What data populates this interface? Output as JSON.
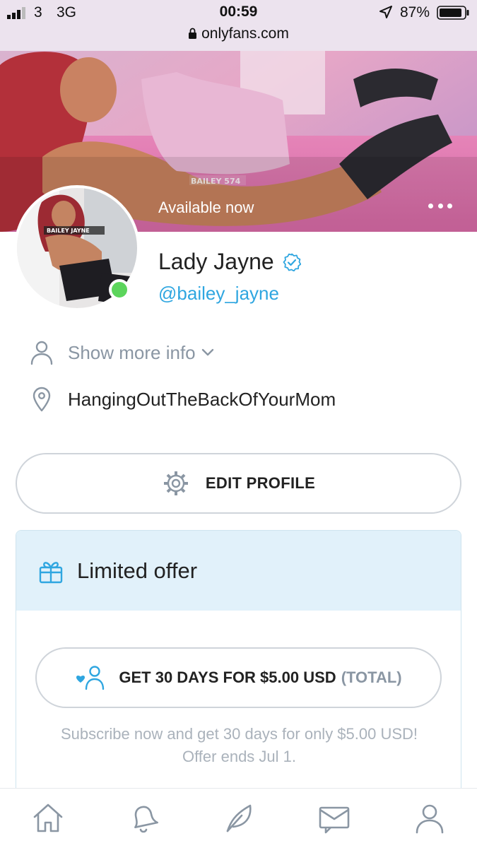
{
  "status_bar": {
    "carrier": "3",
    "network": "3G",
    "time": "00:59",
    "battery_pct": "87%",
    "url": "onlyfans.com"
  },
  "cover": {
    "status": "Available now",
    "watermark": "BAILEY 574"
  },
  "avatar": {
    "watermark": "BAILEY JAYNE",
    "online": true
  },
  "profile": {
    "name": "Lady Jayne",
    "handle": "@bailey_jayne",
    "show_more": "Show more info",
    "location": "HangingOutTheBackOfYourMom"
  },
  "edit_profile": {
    "label": "EDIT PROFILE"
  },
  "offer": {
    "title": "Limited offer",
    "button_label": "GET 30 DAYS FOR $5.00 USD",
    "button_suffix": "(TOTAL)",
    "note_line1": "Subscribe now and get 30 days for only $5.00 USD!",
    "note_line2": "Offer ends Jul 1."
  },
  "nav": {
    "icons": [
      "home-icon",
      "bell-icon",
      "feather-icon",
      "message-icon",
      "user-icon"
    ]
  },
  "colors": {
    "accent": "#2fa6e0",
    "muted": "#8a96a3",
    "offer_bg": "#e1f1fa",
    "online": "#5cd55c"
  }
}
